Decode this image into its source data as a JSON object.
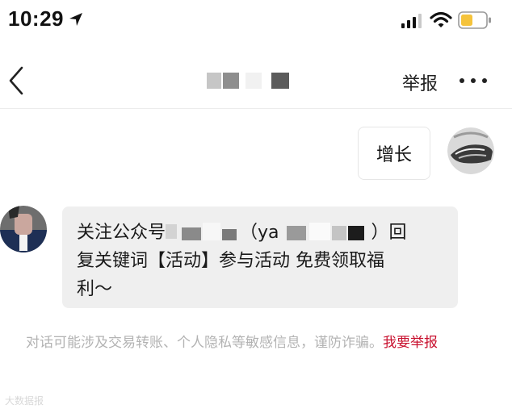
{
  "status_bar": {
    "time": "10:29"
  },
  "nav": {
    "report_label": "举报"
  },
  "messages": {
    "user_text": "增长",
    "bot_line1_a": "关注公众号",
    "bot_line1_b": "（ya",
    "bot_line1_c": "）回",
    "bot_line2": "复关键词【活动】参与活动 免费领取福",
    "bot_line3": "利～"
  },
  "warning": {
    "text": "对话可能涉及交易转账、个人隐私等敏感信息，谨防诈骗。",
    "link": "我要举报"
  },
  "watermark": {
    "text": "大数据报"
  },
  "colors": {
    "link_red": "#c8102e",
    "bubble_gray": "#efefef",
    "battery_yellow": "#f5c33b"
  }
}
